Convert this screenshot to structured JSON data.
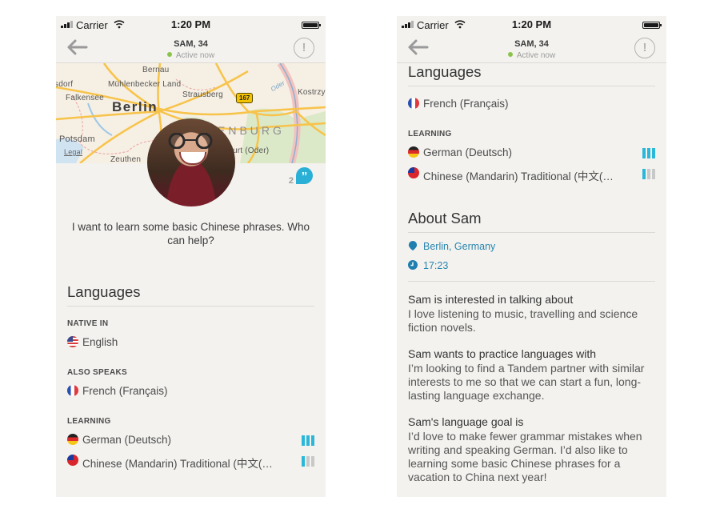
{
  "status_bar": {
    "carrier": "Carrier",
    "time": "1:20 PM"
  },
  "nav": {
    "title": "SAM, 34",
    "status": "Active now",
    "back_icon": "arrow-left-icon",
    "report_icon": "exclamation-circle-icon",
    "report_glyph": "!"
  },
  "map": {
    "labels": [
      "Bernau",
      "Mühlenbecker Land",
      "Falkensee",
      "Berlin",
      "Strausberg",
      "Kostrzy",
      "Potsdam",
      "Zeuthen",
      "furt (Oder)",
      "Legal",
      "ENBURG",
      "Oder"
    ],
    "road_shield": "167",
    "partial_labels": [
      "sdorf"
    ]
  },
  "profile": {
    "quote_count": "2",
    "quote_glyph": "”",
    "motto": "I want to learn some basic Chinese phrases. Who can help?"
  },
  "languages": {
    "title": "Languages",
    "native_label": "NATIVE IN",
    "native": [
      {
        "name": "English",
        "flag": "us"
      }
    ],
    "also_label": "ALSO SPEAKS",
    "also": [
      {
        "name": "French (Français)",
        "flag": "fr"
      }
    ],
    "learning_label": "LEARNING",
    "learning": [
      {
        "name": "German (Deutsch)",
        "flag": "de",
        "level": 3,
        "level_max": 3
      },
      {
        "name": "Chinese (Mandarin) Traditional (中文(…",
        "flag": "tw",
        "level": 1,
        "level_max": 3
      }
    ]
  },
  "about": {
    "title": "About Sam",
    "location": "Berlin, Germany",
    "local_time": "17:23",
    "sections": [
      {
        "heading": "Sam is interested in talking about",
        "body": "I love listening to music, travelling and science fiction novels."
      },
      {
        "heading": "Sam wants to practice languages with",
        "body": "I’m looking to find a Tandem partner with similar interests to me so that we can start a fun, long-lasting language exchange."
      },
      {
        "heading": "Sam's language goal is",
        "body": "I’d love to make fewer grammar mistakes when writing and speaking German. I’d also like to learning some basic Chinese phrases for a vacation to China next year!"
      }
    ]
  },
  "colors": {
    "accent": "#2ab7d8",
    "link": "#2a86b0",
    "online": "#8bc34a",
    "background": "#f3f2ef"
  }
}
